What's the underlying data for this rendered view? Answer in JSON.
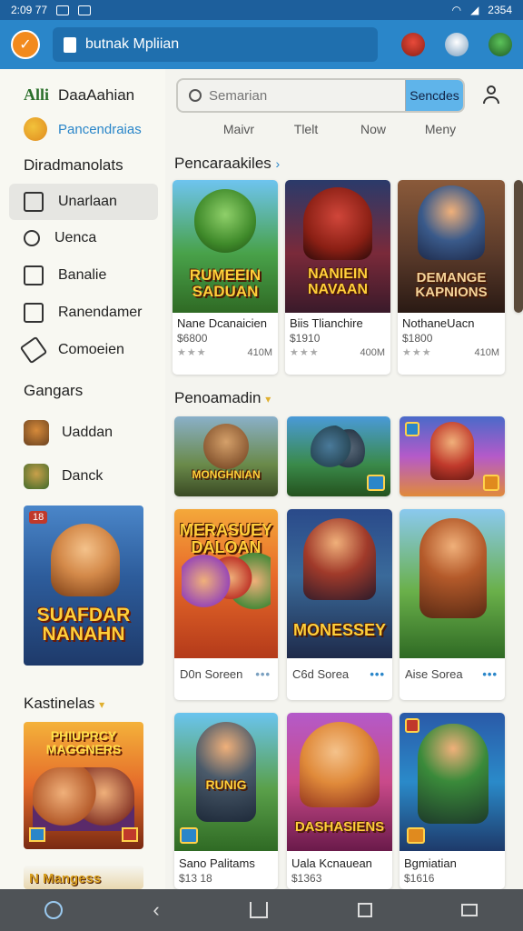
{
  "status_bar": {
    "time": "2:09 77",
    "battery": "2354"
  },
  "app_bar": {
    "search_text": "butnak Mpliian"
  },
  "sidebar": {
    "brand_short": "Alli",
    "brand_name": "DaaAahian",
    "pending_label": "Pancendraias",
    "section_categories": "Diradmanolats",
    "nav": [
      {
        "label": "Unarlaan",
        "icon": "box-icon"
      },
      {
        "label": "Uenca",
        "icon": "magnifier-icon"
      },
      {
        "label": "Banalie",
        "icon": "list-icon"
      },
      {
        "label": "Ranendamer",
        "icon": "home-icon"
      },
      {
        "label": "Comoeien",
        "icon": "tag-icon"
      }
    ],
    "section_games": "Gangars",
    "games": [
      {
        "label": "Uaddan"
      },
      {
        "label": "Danck"
      }
    ],
    "promo": {
      "title": "SUAFDAR NANAHN",
      "badge": "18"
    },
    "section_kastinelas": "Kastinelas",
    "promo2": {
      "title": "PHIUPRCY MAGGNERS"
    },
    "promo3": {
      "title": "N Mangess"
    }
  },
  "main": {
    "search_placeholder": "Semarian",
    "search_button": "Sencdes",
    "tabs": [
      "Maivr",
      "Tlelt",
      "Now",
      "Meny"
    ],
    "section1_title": "Pencaraakiles",
    "row1": [
      {
        "art_title": "RUMEEIN SADUAN",
        "name": "Nane Dcanaicien",
        "price": "$6800",
        "stars": "★★★",
        "size": "410M"
      },
      {
        "art_title": "NANIEIN NAVAAN",
        "name": "Biis Tlianchire",
        "price": "$1910",
        "stars": "★★★",
        "size": "400M"
      },
      {
        "art_title": "DEMANGE KAPNIONS",
        "name": "NothaneUacn",
        "price": "$1800",
        "stars": "★★★",
        "size": "410M"
      }
    ],
    "section2_title": "Penoamadin",
    "row2": [
      {
        "art_title": "MONGHNIAN"
      },
      {
        "art_title": ""
      },
      {
        "art_title": ""
      }
    ],
    "row3": [
      {
        "art_title": "MERASUEY DALOAN",
        "name": "D0n Soreen"
      },
      {
        "art_title": "MONESSEY",
        "name": "C6d Sorea"
      },
      {
        "art_title": "",
        "name": "Aise Sorea"
      }
    ],
    "row4": [
      {
        "art_title": "RUNIG",
        "name": "Sano Palitams",
        "price": "$13 18"
      },
      {
        "art_title": "DASHASIENS",
        "name": "Uala Kcnauean",
        "price": "$1363"
      },
      {
        "art_title": "",
        "name": "Bgmiatian",
        "price": "$1616"
      }
    ]
  },
  "colors": {
    "accent": "#2a86c9",
    "status": "#1d5f9c",
    "nav": "#4f5357"
  }
}
